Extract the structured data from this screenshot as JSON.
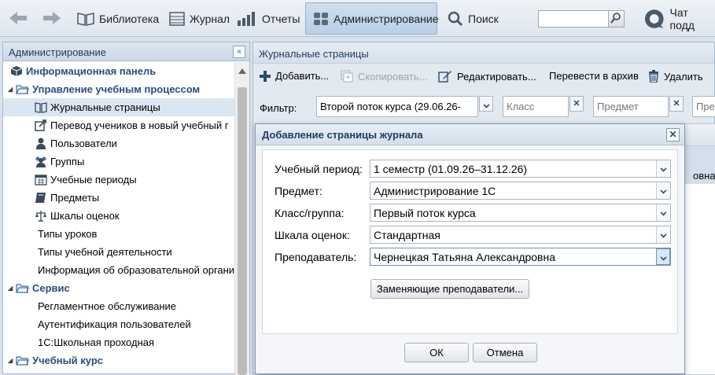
{
  "topbar": {
    "library": "Библиотека",
    "journal": "Журнал",
    "reports": "Отчеты",
    "admin": "Администрирование",
    "search": "Поиск",
    "search_value": "",
    "chat": "Чат подд"
  },
  "left": {
    "title": "Администрирование",
    "items": [
      {
        "label": "Информационная панель"
      },
      {
        "label": "Управление учебным процессом"
      },
      {
        "label": "Журнальные страницы"
      },
      {
        "label": "Перевод учеников в новый учебный г"
      },
      {
        "label": "Пользователи"
      },
      {
        "label": "Группы"
      },
      {
        "label": "Учебные периоды"
      },
      {
        "label": "Предметы"
      },
      {
        "label": "Шкалы оценок"
      },
      {
        "label": "Типы уроков"
      },
      {
        "label": "Типы учебной деятельности"
      },
      {
        "label": "Информация об образовательной органи"
      },
      {
        "label": "Сервис"
      },
      {
        "label": "Регламентное обслуживание"
      },
      {
        "label": "Аутентификация пользователей"
      },
      {
        "label": "1С:Школьная проходная"
      },
      {
        "label": "Учебный курс"
      }
    ]
  },
  "right": {
    "title": "Журнальные страницы",
    "toolbar": {
      "add": "Добавить...",
      "copy": "Скопировать...",
      "edit": "Редактировать...",
      "archive": "Перевести в архив",
      "delete": "Удалить"
    },
    "filter": {
      "label": "Фильтр:",
      "stream": "Второй поток курса (29.06.26-",
      "class_ph": "Класс",
      "subject_ph": "Предмет",
      "teacher_ph": "Пре"
    },
    "peek_text": "овна"
  },
  "dialog": {
    "title": "Добавление страницы журнала",
    "fields": [
      {
        "label": "Учебный период:",
        "value": "1 семестр (01.09.26–31.12.26)"
      },
      {
        "label": "Предмет:",
        "value": "Администрирование 1С"
      },
      {
        "label": "Класс/группа:",
        "value": "Первый поток курса"
      },
      {
        "label": "Шкала оценок:",
        "value": "Стандартная"
      },
      {
        "label": "Преподаватель:",
        "value": "Чернецкая Татьяна Александровна"
      }
    ],
    "alt_teachers": "Заменяющие преподаватели...",
    "ok": "ОК",
    "cancel": "Отмена"
  },
  "colors": {
    "accent": "#2b4e7a",
    "selection": "#dbe6f3",
    "toolbar_active": "#b9cfe6"
  }
}
